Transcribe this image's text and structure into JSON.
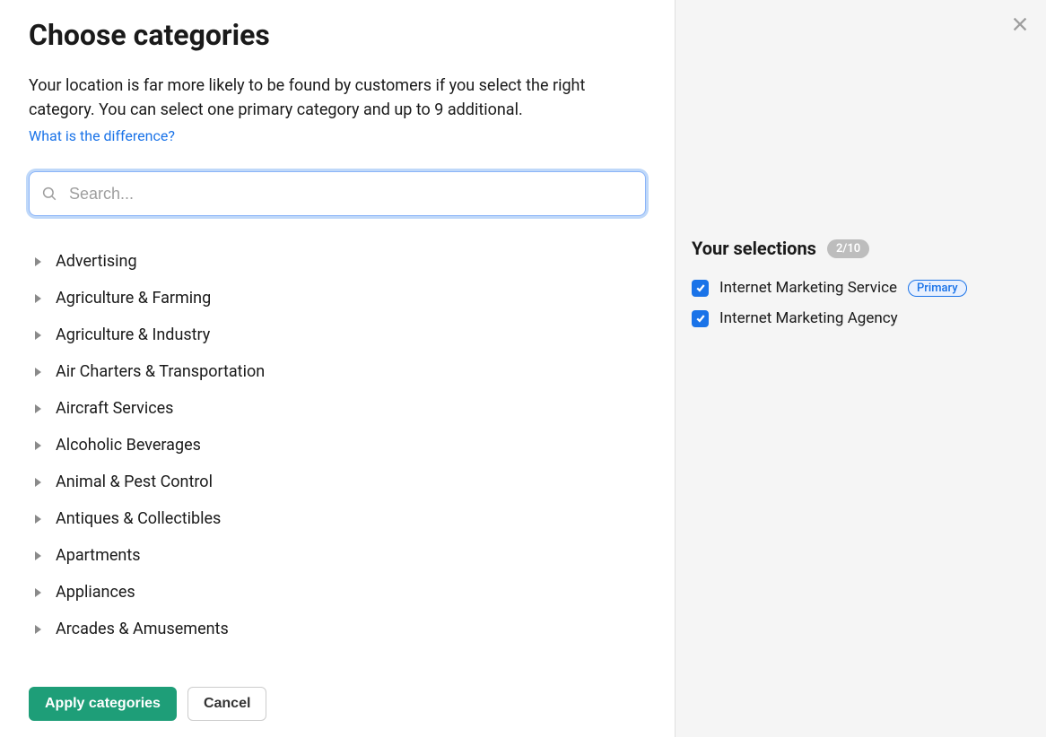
{
  "header": {
    "title": "Choose categories",
    "description": "Your location is far more likely to be found by customers if you select the right category. You can select one primary category and up to 9 additional.",
    "link": "What is the difference?"
  },
  "search": {
    "placeholder": "Search..."
  },
  "categories": [
    "Advertising",
    "Agriculture & Farming",
    "Agriculture & Industry",
    "Air Charters & Transportation",
    "Aircraft Services",
    "Alcoholic Beverages",
    "Animal & Pest Control",
    "Antiques & Collectibles",
    "Apartments",
    "Appliances",
    "Arcades & Amusements"
  ],
  "footer": {
    "apply": "Apply categories",
    "cancel": "Cancel"
  },
  "selections": {
    "title": "Your selections",
    "count": "2/10",
    "primary_badge": "Primary",
    "items": [
      {
        "label": "Internet Marketing Service",
        "primary": true
      },
      {
        "label": "Internet Marketing Agency",
        "primary": false
      }
    ]
  }
}
